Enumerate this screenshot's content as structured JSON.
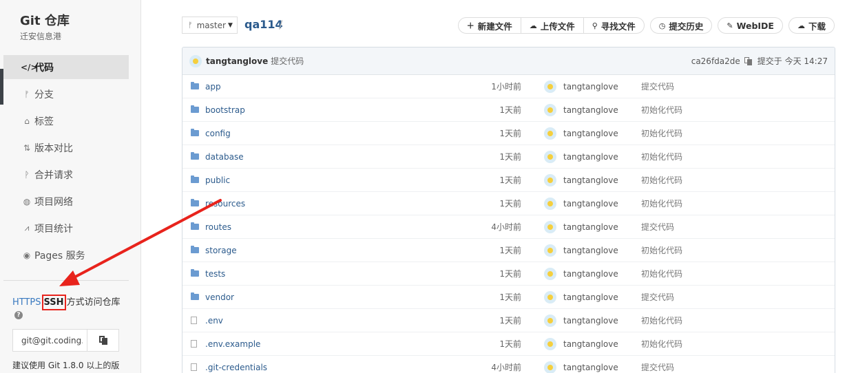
{
  "sidebar": {
    "title": "Git 仓库",
    "subtitle": "迁安信息港",
    "nav": [
      {
        "label": "代码",
        "icon": "code-icon",
        "glyph": "</>",
        "active": true
      },
      {
        "label": "分支",
        "icon": "branch-icon",
        "glyph": "ᚠ"
      },
      {
        "label": "标签",
        "icon": "tag-icon",
        "glyph": "⌂"
      },
      {
        "label": "版本对比",
        "icon": "compare-icon",
        "glyph": "⇅"
      },
      {
        "label": "合并请求",
        "icon": "merge-request-icon",
        "glyph": "ᚹ"
      },
      {
        "label": "项目网络",
        "icon": "network-icon",
        "glyph": "◍"
      },
      {
        "label": "项目统计",
        "icon": "stats-icon",
        "glyph": "⩘"
      },
      {
        "label": "Pages 服务",
        "icon": "pages-icon",
        "glyph": "◉"
      }
    ],
    "access": {
      "https": "HTTPS",
      "ssh": "SSH",
      "suffix": "方式访问仓库"
    },
    "clone_url": "git@git.coding.",
    "hint": "建议使用 Git 1.8.0 以上的版"
  },
  "header": {
    "branch": "master",
    "repo": "qa114",
    "separator": "/",
    "buttons": {
      "new_file": "新建文件",
      "upload": "上传文件",
      "find": "寻找文件",
      "history": "提交历史",
      "webide": "WebIDE",
      "download": "下载"
    }
  },
  "commit": {
    "user": "tangtanglove",
    "message": "提交代码",
    "hash": "ca26fda2de",
    "time": "提交于 今天 14:27"
  },
  "files": [
    {
      "name": "app",
      "type": "folder",
      "time": "1小时前",
      "author": "tangtanglove",
      "message": "提交代码"
    },
    {
      "name": "bootstrap",
      "type": "folder",
      "time": "1天前",
      "author": "tangtanglove",
      "message": "初始化代码"
    },
    {
      "name": "config",
      "type": "folder",
      "time": "1天前",
      "author": "tangtanglove",
      "message": "初始化代码"
    },
    {
      "name": "database",
      "type": "folder",
      "time": "1天前",
      "author": "tangtanglove",
      "message": "初始化代码"
    },
    {
      "name": "public",
      "type": "folder",
      "time": "1天前",
      "author": "tangtanglove",
      "message": "初始化代码"
    },
    {
      "name": "resources",
      "type": "folder",
      "time": "1天前",
      "author": "tangtanglove",
      "message": "初始化代码"
    },
    {
      "name": "routes",
      "type": "folder",
      "time": "4小时前",
      "author": "tangtanglove",
      "message": "提交代码"
    },
    {
      "name": "storage",
      "type": "folder",
      "time": "1天前",
      "author": "tangtanglove",
      "message": "初始化代码"
    },
    {
      "name": "tests",
      "type": "folder",
      "time": "1天前",
      "author": "tangtanglove",
      "message": "初始化代码"
    },
    {
      "name": "vendor",
      "type": "folder",
      "time": "1天前",
      "author": "tangtanglove",
      "message": "提交代码"
    },
    {
      "name": ".env",
      "type": "file",
      "time": "1天前",
      "author": "tangtanglove",
      "message": "初始化代码"
    },
    {
      "name": ".env.example",
      "type": "file",
      "time": "1天前",
      "author": "tangtanglove",
      "message": "初始化代码"
    },
    {
      "name": ".git-credentials",
      "type": "file",
      "time": "4小时前",
      "author": "tangtanglove",
      "message": "提交代码"
    }
  ],
  "colors": {
    "link": "#2b5a8c",
    "annotation": "#e8231c",
    "folder": "#6b9bd1"
  }
}
